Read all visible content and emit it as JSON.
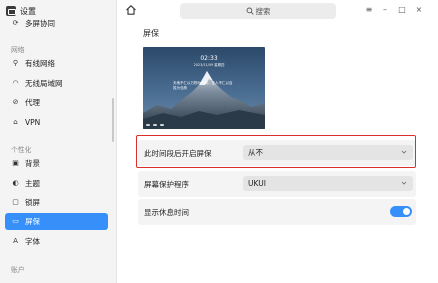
{
  "app": {
    "title": "设置"
  },
  "sidebar": {
    "top_item": {
      "icon": "sync-icon",
      "label": "多屏协同"
    },
    "groups": [
      {
        "label": "网络"
      },
      {
        "label": "个性化"
      },
      {
        "label": "账户"
      }
    ],
    "items": [
      {
        "icon": "wired-network-icon",
        "label": "有线网络"
      },
      {
        "icon": "wifi-icon",
        "label": "无线局域网"
      },
      {
        "icon": "proxy-icon",
        "label": "代理"
      },
      {
        "icon": "vpn-icon",
        "label": "VPN"
      },
      {
        "icon": "background-icon",
        "label": "背景"
      },
      {
        "icon": "theme-icon",
        "label": "主题"
      },
      {
        "icon": "lock-screen-icon",
        "label": "锁屏"
      },
      {
        "icon": "screensaver-icon",
        "label": "屏保",
        "active": true
      },
      {
        "icon": "font-icon",
        "label": "字体"
      }
    ]
  },
  "topbar": {
    "search_placeholder": "搜索",
    "menu_glyph": "≡",
    "minimize_glyph": "–",
    "maximize_glyph": "□",
    "close_glyph": "×"
  },
  "main": {
    "section_title": "屏保",
    "preview": {
      "time": "02:33",
      "date": "2023/11/09 星期四",
      "quote": "天地不仁以万物为刍狗，圣人不仁以百姓为刍狗"
    },
    "settings": [
      {
        "label": "此时间段后开启屏保",
        "value": "从不"
      },
      {
        "label": "屏幕保护程序",
        "value": "UKUI"
      },
      {
        "label": "显示休息时间",
        "toggle": true
      }
    ]
  },
  "colors": {
    "accent": "#3790fa",
    "highlight": "#d9302c"
  }
}
